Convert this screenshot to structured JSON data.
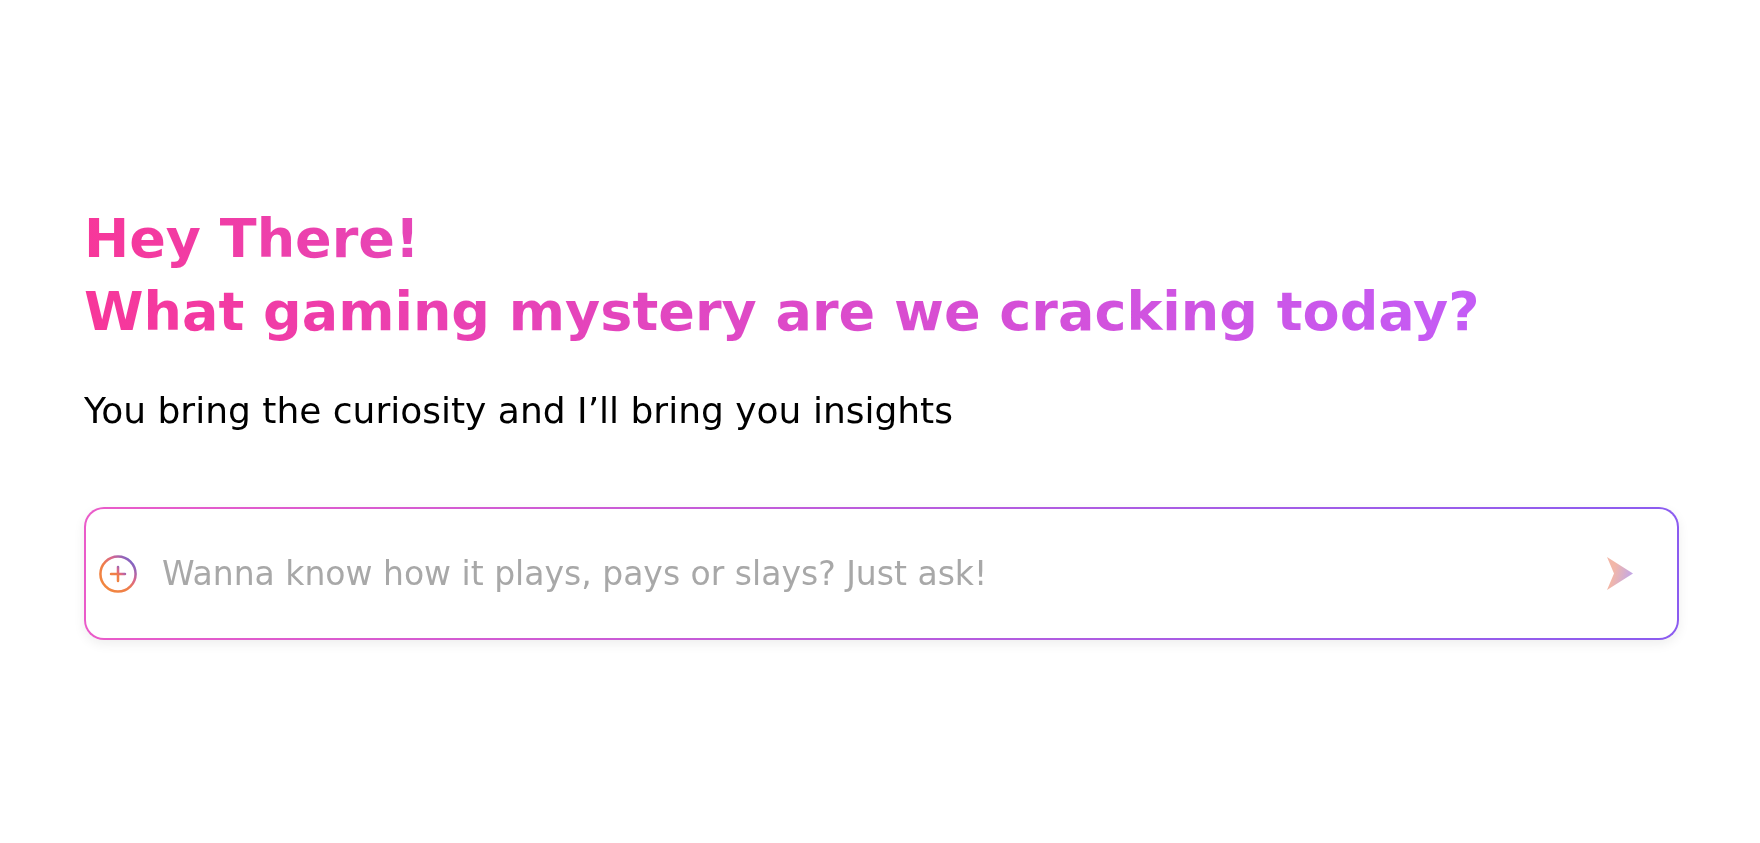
{
  "greeting": "Hey There!",
  "headline": "What gaming mystery are we cracking today?",
  "subtitle": "You bring the curiosity and I’ll bring you insights",
  "chat_input": {
    "placeholder": "Wanna know how it plays, pays or slays? Just ask!"
  },
  "send_button": {
    "disabled": true
  }
}
